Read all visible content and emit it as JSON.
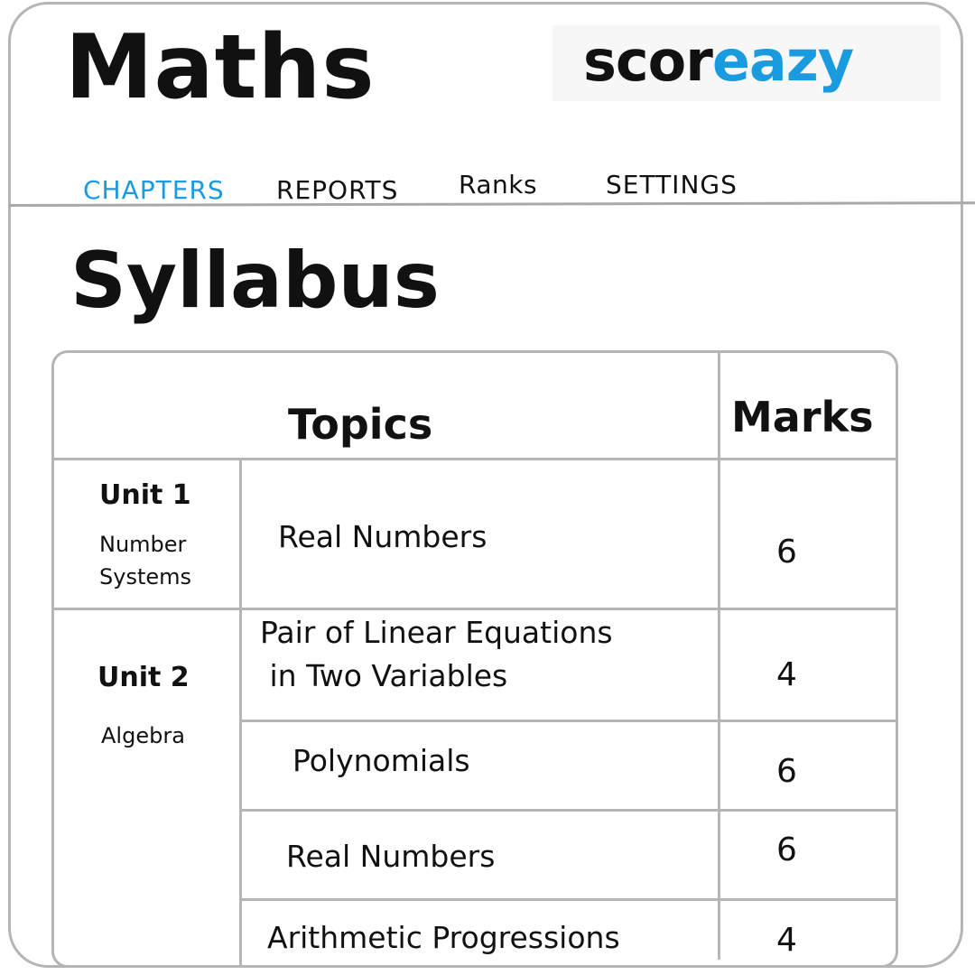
{
  "app": {
    "title": "Maths"
  },
  "logo": {
    "part_dark": "scor",
    "part_blue": "eazy"
  },
  "tabs": [
    {
      "label": "CHAPTERS",
      "active": true
    },
    {
      "label": "REPORTS",
      "active": false
    },
    {
      "label": "Ranks",
      "active": false
    },
    {
      "label": "SETTINGS",
      "active": false
    }
  ],
  "section": {
    "title": "Syllabus"
  },
  "table": {
    "header_topics": "Topics",
    "header_marks": "Marks",
    "units": [
      {
        "title": "Unit 1",
        "subtitle_line1": "Number",
        "subtitle_line2": "Systems"
      },
      {
        "title": "Unit 2",
        "subtitle": "Algebra"
      }
    ],
    "rows": [
      {
        "topic": "Real Numbers",
        "marks": "6"
      },
      {
        "topic_line1": "Pair of Linear Equations",
        "topic_line2": " in Two Variables",
        "marks": "4"
      },
      {
        "topic": "Polynomials",
        "marks": "6"
      },
      {
        "topic": "Real Numbers",
        "marks": "6"
      },
      {
        "topic": "Arithmetic Progressions",
        "marks": "4"
      }
    ]
  },
  "colors": {
    "accent": "#1a9be0",
    "border": "#b5b5b5",
    "text": "#111111"
  }
}
